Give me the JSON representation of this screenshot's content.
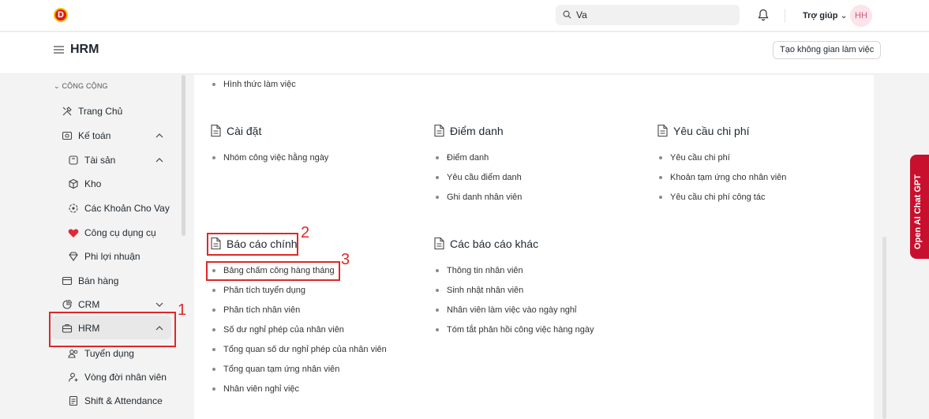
{
  "navbar": {
    "logo_letter": "D",
    "search_value": "Va",
    "help_label": "Trợ giúp",
    "avatar_initials": "HH"
  },
  "page_header": {
    "title": "HRM",
    "workspace_button": "Tạo không gian làm việc"
  },
  "sidebar": {
    "group_label": "CÔNG CỘNG",
    "items": [
      {
        "label": "Trang Chủ",
        "icon": "tools-icon"
      },
      {
        "label": "Kế toán",
        "icon": "safe-icon"
      },
      {
        "label": "Tài sản",
        "icon": "box-icon"
      },
      {
        "label": "Kho",
        "icon": "package-icon"
      },
      {
        "label": "Các Khoản Cho Vay",
        "icon": "loan-icon"
      },
      {
        "label": "Công cụ dụng cụ",
        "icon": "heart-icon"
      },
      {
        "label": "Phi lợi nhuận",
        "icon": "diamond-icon"
      },
      {
        "label": "Bán hàng",
        "icon": "card-icon"
      },
      {
        "label": "CRM",
        "icon": "chart-icon"
      },
      {
        "label": "HRM",
        "icon": "briefcase-icon"
      },
      {
        "label": "Tuyển dụng",
        "icon": "users-icon"
      },
      {
        "label": "Vòng đời nhân viên",
        "icon": "user-add-icon"
      },
      {
        "label": "Shift & Attendance",
        "icon": "clipboard-icon"
      }
    ]
  },
  "main": {
    "top_link": "Hình thức làm việc",
    "cards": [
      {
        "title": "Cài đặt",
        "links": [
          "Nhóm công việc hằng ngày"
        ]
      },
      {
        "title": "Điểm danh",
        "links": [
          "Điểm danh",
          "Yêu cầu điểm danh",
          "Ghi danh nhân viên"
        ]
      },
      {
        "title": "Yêu cầu chi phí",
        "links": [
          "Yêu cầu chi phí",
          "Khoản tạm ứng cho nhân viên",
          "Yêu cầu chi phí công tác"
        ]
      },
      {
        "title": "Báo cáo chính",
        "links": [
          "Bảng chấm công hàng tháng",
          "Phân tích tuyển dụng",
          "Phân tích nhân viên",
          "Số dư nghỉ phép của nhân viên",
          "Tổng quan số dư nghỉ phép của nhân viên",
          "Tổng quan tạm ứng nhân viên",
          "Nhân viên nghỉ việc"
        ]
      },
      {
        "title": "Các báo cáo khác",
        "links": [
          "Thông tin nhân viên",
          "Sinh nhật nhân viên",
          "Nhân viên làm việc vào ngày nghỉ",
          "Tóm tắt phản hồi công việc hàng ngày"
        ]
      }
    ]
  },
  "annotations": {
    "n1": "1",
    "n2": "2",
    "n3": "3"
  },
  "gpt_tab_label": "Open AI Chat GPT",
  "colors": {
    "brand_red": "#c8102e",
    "annotation_red": "#e02727"
  }
}
